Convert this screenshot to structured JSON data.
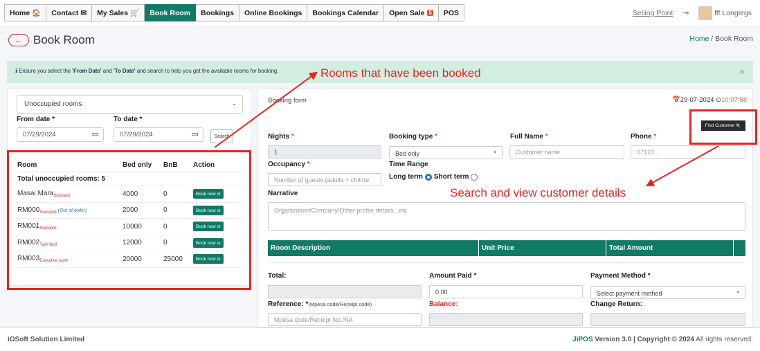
{
  "nav": {
    "tabs": [
      {
        "label": "Home",
        "icon": "home-icon",
        "glyph": "🏠"
      },
      {
        "label": "Contact",
        "icon": "envelope-icon",
        "glyph": "✉"
      },
      {
        "label": "My Sales",
        "icon": "cart-icon",
        "glyph": "🛒"
      },
      {
        "label": "Book Room",
        "active": true
      },
      {
        "label": "Bookings"
      },
      {
        "label": "Online Bookings"
      },
      {
        "label": "Bookings Calendar"
      },
      {
        "label": "Open Sale",
        "badge": "5"
      },
      {
        "label": "POS"
      }
    ],
    "selling_point": "Selling Point",
    "logout_glyph": "⇥",
    "user": "fff Longlegs"
  },
  "header": {
    "back_glyph": "←",
    "title": "Book Room",
    "breadcrumb": {
      "home": "Home",
      "sep": "/",
      "current": "Book Room"
    }
  },
  "alert": {
    "icon_glyph": "ℹ",
    "text_1": " Ensure you select the ",
    "bold_1": "'From Date'",
    "text_2": " and ",
    "bold_2": "'To Date'",
    "text_3": " and search to help you get the available rooms for booking.",
    "close": "×"
  },
  "annotations": {
    "booked": "Rooms that have been booked",
    "customer": "Search and view customer details"
  },
  "filters": {
    "room_filter": "Unoccupied rooms",
    "from_label": "From date *",
    "from_value": "07/29/2024",
    "to_label": "To date *",
    "to_value": "07/29/2024",
    "search": "Search",
    "cal_glyph": "▭",
    "caret": "⌄"
  },
  "rooms": {
    "columns": [
      "Room",
      "Bed only",
      "BnB",
      "Action"
    ],
    "total_label": "Total unoccupied rooms: 5",
    "book_label": "Book now ⊖",
    "rows": [
      {
        "name": "Masai Mara",
        "type": "Standard",
        "note": "",
        "bed_only": "4000",
        "bnb": "0"
      },
      {
        "name": "RM000",
        "type": "Standard",
        "note": "(Out of order)",
        "bed_only": "2000",
        "bnb": "0"
      },
      {
        "name": "RM001",
        "type": "Standard",
        "note": "",
        "bed_only": "10000",
        "bnb": "0"
      },
      {
        "name": "RM002",
        "type": "Twin Bed",
        "note": "",
        "bed_only": "12000",
        "bnb": "0"
      },
      {
        "name": "RM003",
        "type": "Executive room",
        "note": "",
        "bed_only": "20000",
        "bnb": "25000"
      }
    ]
  },
  "form": {
    "title": "Booking form",
    "date_glyph": "📅",
    "date": "29-07-2024",
    "clock_glyph": "⊙",
    "time": "10:07:58",
    "find_customer": "Find Customer",
    "search_glyph": "🔍",
    "nights_label": "Nights",
    "nights_value": "1",
    "booking_type_label": "Booking type",
    "booking_type_value": "Bed only",
    "full_name_label": "Full Name",
    "full_name_placeholder": "Customer name",
    "phone_label": "Phone",
    "phone_placeholder": "07123...",
    "occupancy_label": "Occupancy",
    "occupancy_placeholder": "Number of guests (adults + childre",
    "time_range_label": "Time Range",
    "long_term": "Long term",
    "short_term": "Short term",
    "narrative_label": "Narrative",
    "narrative_placeholder": "Organization/Company/Other profile details...etc",
    "table_cols": [
      "Room Description",
      "Unit Price",
      "Total Amount"
    ],
    "total_label": "Total:",
    "amount_paid_label": "Amount Paid",
    "amount_paid_value": "0.00",
    "payment_method_label": "Payment Method",
    "payment_method_value": "Select payment method",
    "reference_label": "Reference:",
    "reference_hint": "(Mpesa code/Receipt code)",
    "reference_placeholder": "Mpesa code/Receipt No./NA",
    "balance_label": "Balance:",
    "change_label": "Change Return:",
    "star": " *",
    "caret": "▾"
  },
  "footer": {
    "company": "iOSoft Solution Limited",
    "brand": "JiPOS",
    "version": " Version 3.0 | Copyright © 2024",
    "rights": " All rights reserved."
  },
  "colors": {
    "accent": "#117a65",
    "annotation": "#e8221e",
    "alert_bg": "#d4ede1"
  }
}
